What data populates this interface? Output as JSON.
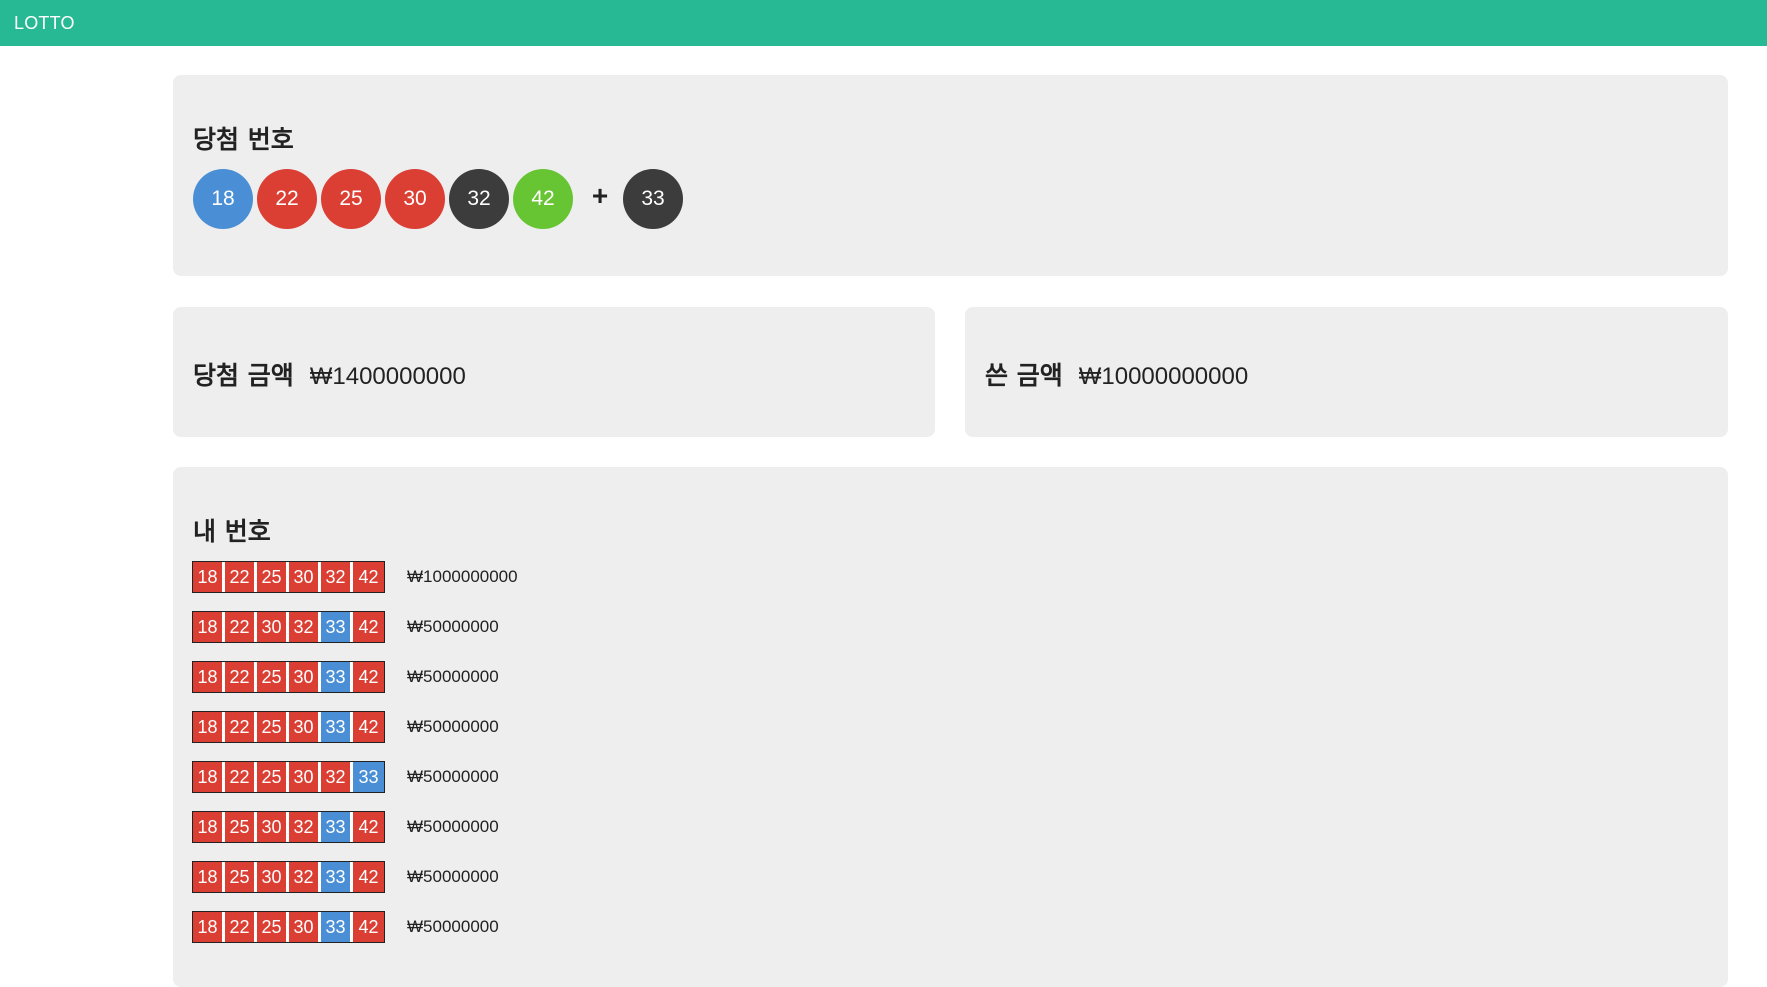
{
  "header": {
    "brand": "LOTTO"
  },
  "colors": {
    "header": "#27b993",
    "hit": "#db3e33",
    "bonus_hit": "#4a8fd6",
    "ball_blue": "#4a8fd6",
    "ball_red": "#db3e33",
    "ball_dark": "#3c3c3c",
    "ball_green": "#67c534"
  },
  "winning": {
    "title": "당첨 번호",
    "numbers": [
      {
        "value": "18",
        "color": "#4a8fd6"
      },
      {
        "value": "22",
        "color": "#db3e33"
      },
      {
        "value": "25",
        "color": "#db3e33"
      },
      {
        "value": "30",
        "color": "#db3e33"
      },
      {
        "value": "32",
        "color": "#3c3c3c"
      },
      {
        "value": "42",
        "color": "#67c534"
      }
    ],
    "plus": "+",
    "bonus": {
      "value": "33",
      "color": "#3c3c3c"
    }
  },
  "prize": {
    "label": "당첨 금액",
    "value": "₩1400000000"
  },
  "spent": {
    "label": "쓴 금액",
    "value": "₩10000000000"
  },
  "mine": {
    "title": "내 번호",
    "tickets": [
      {
        "numbers": [
          [
            "18",
            "hit"
          ],
          [
            "22",
            "hit"
          ],
          [
            "25",
            "hit"
          ],
          [
            "30",
            "hit"
          ],
          [
            "32",
            "hit"
          ],
          [
            "42",
            "hit"
          ]
        ],
        "prize": "₩1000000000"
      },
      {
        "numbers": [
          [
            "18",
            "hit"
          ],
          [
            "22",
            "hit"
          ],
          [
            "30",
            "hit"
          ],
          [
            "32",
            "hit"
          ],
          [
            "33",
            "bonus"
          ],
          [
            "42",
            "hit"
          ]
        ],
        "prize": "₩50000000"
      },
      {
        "numbers": [
          [
            "18",
            "hit"
          ],
          [
            "22",
            "hit"
          ],
          [
            "25",
            "hit"
          ],
          [
            "30",
            "hit"
          ],
          [
            "33",
            "bonus"
          ],
          [
            "42",
            "hit"
          ]
        ],
        "prize": "₩50000000"
      },
      {
        "numbers": [
          [
            "18",
            "hit"
          ],
          [
            "22",
            "hit"
          ],
          [
            "25",
            "hit"
          ],
          [
            "30",
            "hit"
          ],
          [
            "33",
            "bonus"
          ],
          [
            "42",
            "hit"
          ]
        ],
        "prize": "₩50000000"
      },
      {
        "numbers": [
          [
            "18",
            "hit"
          ],
          [
            "22",
            "hit"
          ],
          [
            "25",
            "hit"
          ],
          [
            "30",
            "hit"
          ],
          [
            "32",
            "hit"
          ],
          [
            "33",
            "bonus"
          ]
        ],
        "prize": "₩50000000"
      },
      {
        "numbers": [
          [
            "18",
            "hit"
          ],
          [
            "25",
            "hit"
          ],
          [
            "30",
            "hit"
          ],
          [
            "32",
            "hit"
          ],
          [
            "33",
            "bonus"
          ],
          [
            "42",
            "hit"
          ]
        ],
        "prize": "₩50000000"
      },
      {
        "numbers": [
          [
            "18",
            "hit"
          ],
          [
            "25",
            "hit"
          ],
          [
            "30",
            "hit"
          ],
          [
            "32",
            "hit"
          ],
          [
            "33",
            "bonus"
          ],
          [
            "42",
            "hit"
          ]
        ],
        "prize": "₩50000000"
      },
      {
        "numbers": [
          [
            "18",
            "hit"
          ],
          [
            "22",
            "hit"
          ],
          [
            "25",
            "hit"
          ],
          [
            "30",
            "hit"
          ],
          [
            "33",
            "bonus"
          ],
          [
            "42",
            "hit"
          ]
        ],
        "prize": "₩50000000"
      }
    ]
  }
}
